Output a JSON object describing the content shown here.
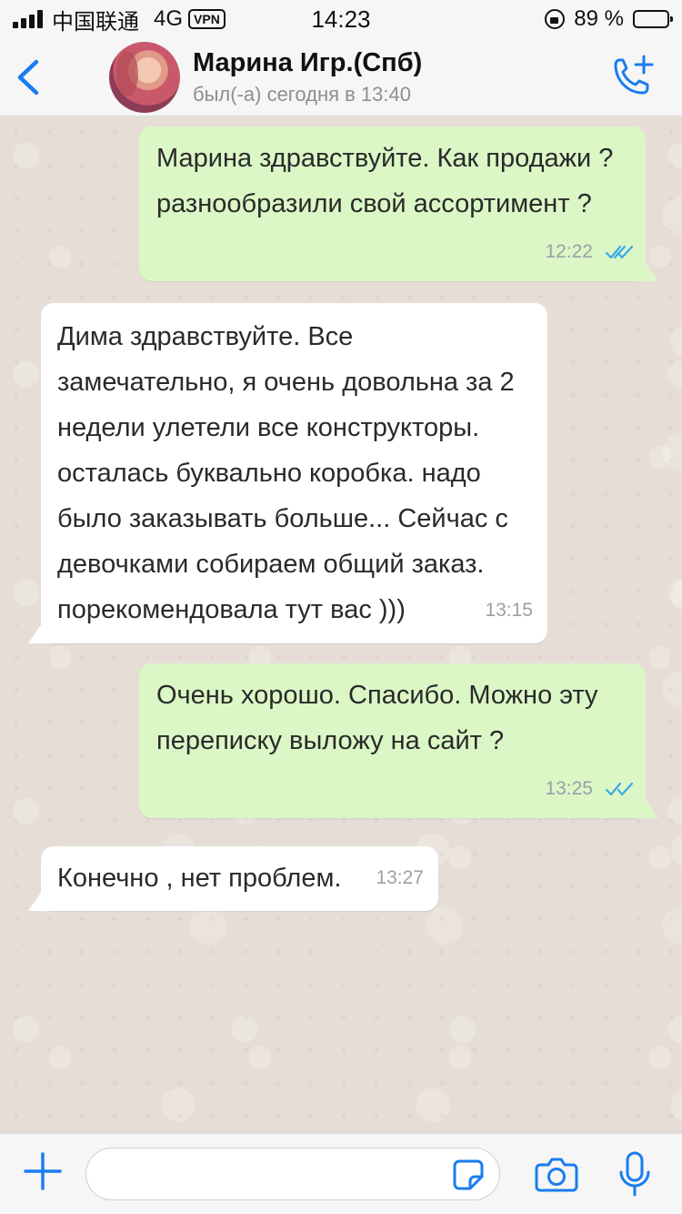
{
  "status_bar": {
    "carrier": "中国联通",
    "network": "4G",
    "vpn": "VPN",
    "time": "14:23",
    "battery_percent": "89 %",
    "battery_level": 0.89
  },
  "header": {
    "contact_name": "Марина Игр.(Спб)",
    "last_seen": "был(-а) сегодня в 13:40",
    "icons": {
      "back": "chevron-left-icon",
      "call": "add-call-icon"
    }
  },
  "messages": [
    {
      "direction": "out",
      "text": "Марина здравствуйте. Как продажи ?\nразнообразили свой ассортимент ?",
      "time": "12:22",
      "read": true
    },
    {
      "direction": "in",
      "text": "Дима здравствуйте. Все\nзамечательно, я очень довольна за 2\nнедели улетели все конструкторы.\nосталась буквально коробка. надо\nбыло заказывать больше...  Сейчас с\nдевочками собираем общий заказ.\nпорекомендовала тут вас )))",
      "time": "13:15"
    },
    {
      "direction": "out",
      "text": "Очень хорошо. Спасибо. Можно эту\nпереписку выложу на сайт ?",
      "time": "13:25",
      "read": true
    },
    {
      "direction": "in",
      "text": "Конечно , нет проблем.",
      "time": "13:27"
    }
  ],
  "input_bar": {
    "message_value": "",
    "icons": [
      "plus-icon",
      "sticker-icon",
      "camera-icon",
      "microphone-icon"
    ]
  },
  "colors": {
    "accent": "#1a7cf0",
    "outgoing_bubble": "#dbf7c6",
    "incoming_bubble": "#ffffff",
    "read_ticks": "#3ea8e6",
    "chat_background": "#e6ded6"
  }
}
